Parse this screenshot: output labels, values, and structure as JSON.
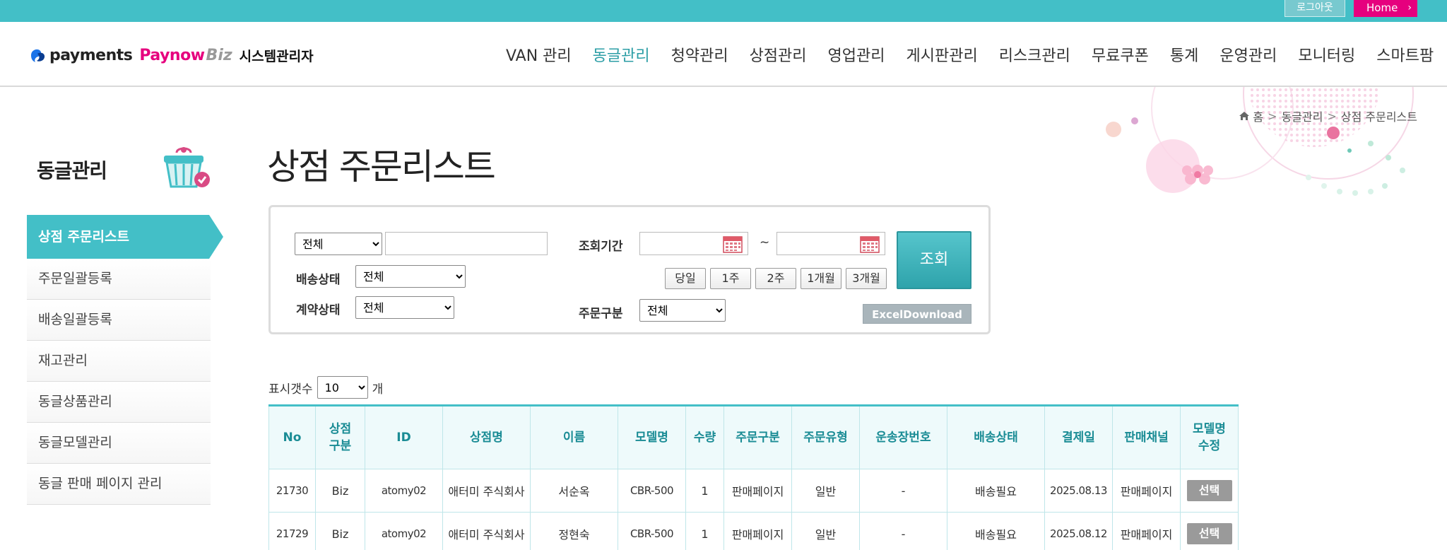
{
  "topbar": {
    "logout_label": "로그아웃",
    "home_label": "Home",
    "home_chevron": "›"
  },
  "logo": {
    "brand1": "payments",
    "brand2": "Paynow",
    "brand3": "Biz",
    "system": "시스템관리자"
  },
  "gnb": [
    "VAN 관리",
    "동글관리",
    "청약관리",
    "상점관리",
    "영업관리",
    "게시판관리",
    "리스크관리",
    "무료쿠폰",
    "통계",
    "운영관리",
    "모니터링",
    "스마트팜"
  ],
  "gnb_active": "동글관리",
  "breadcrumb": {
    "home": "홈",
    "section": "동글관리",
    "current": "상점 주문리스트",
    "separator": ">"
  },
  "lnb": {
    "title": "동글관리",
    "items": [
      "상점 주문리스트",
      "주문일괄등록",
      "배송일괄등록",
      "재고관리",
      "동글상품관리",
      "동글모델관리",
      "동글 판매 페이지 관리"
    ]
  },
  "page_title": "상점 주문리스트",
  "search": {
    "keyword_type": "전체",
    "keyword_value": "",
    "delivery_label": "배송상태",
    "delivery_value": "전체",
    "contract_label": "계약상태",
    "contract_value": "전체",
    "period_label": "조회기간",
    "date_from": "",
    "date_to": "",
    "tilde": "~",
    "period_buttons": [
      "당일",
      "1주",
      "2주",
      "1개월",
      "3개월"
    ],
    "order_type_label": "주문구분",
    "order_type_value": "전체",
    "search_button": "조회",
    "excel_button": "ExcelDownload"
  },
  "count": {
    "label": "표시갯수",
    "value": "10",
    "unit": "개"
  },
  "table": {
    "headers": [
      "No",
      "상점\n구분",
      "ID",
      "상점명",
      "이름",
      "모델명",
      "수량",
      "주문구분",
      "주문유형",
      "운송장번호",
      "배송상태",
      "결제일",
      "판매채널",
      "모델명\n수정"
    ],
    "rows": [
      [
        "21730",
        "Biz",
        "atomy02",
        "애터미 주식회사",
        "서순옥",
        "CBR-500",
        "1",
        "판매페이지",
        "일반",
        "-",
        "배송필요",
        "2025.08.13",
        "판매페이지",
        "선택"
      ],
      [
        "21729",
        "Biz",
        "atomy02",
        "애터미 주식회사",
        "정현숙",
        "CBR-500",
        "1",
        "판매페이지",
        "일반",
        "-",
        "배송필요",
        "2025.08.12",
        "판매페이지",
        "선택"
      ]
    ]
  }
}
